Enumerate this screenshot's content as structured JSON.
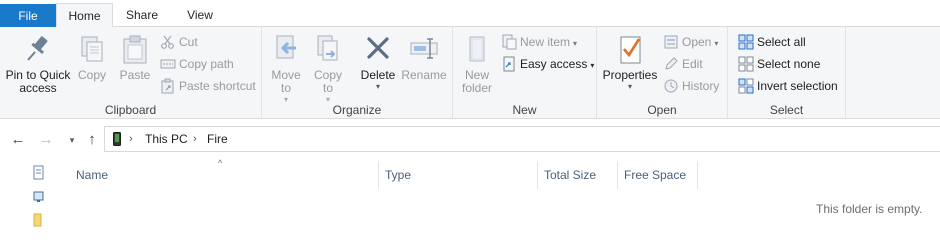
{
  "tabs": {
    "file": "File",
    "home": "Home",
    "share": "Share",
    "view": "View"
  },
  "ribbon": {
    "clipboard": {
      "label": "Clipboard",
      "pin": "Pin to Quick access",
      "copy": "Copy",
      "paste": "Paste",
      "cut": "Cut",
      "copy_path": "Copy path",
      "paste_shortcut": "Paste shortcut"
    },
    "organize": {
      "label": "Organize",
      "move_to": "Move to",
      "copy_to": "Copy to",
      "delete": "Delete",
      "rename": "Rename"
    },
    "new": {
      "label": "New",
      "new_folder": "New folder",
      "new_item": "New item",
      "easy_access": "Easy access"
    },
    "open": {
      "label": "Open",
      "properties": "Properties",
      "open": "Open",
      "edit": "Edit",
      "history": "History"
    },
    "select": {
      "label": "Select",
      "select_all": "Select all",
      "select_none": "Select none",
      "invert_selection": "Invert selection"
    }
  },
  "address": {
    "path": [
      "This PC",
      "Fire"
    ]
  },
  "columns": {
    "name": "Name",
    "type": "Type",
    "total_size": "Total Size",
    "free_space": "Free Space"
  },
  "content": {
    "empty_message": "This folder is empty."
  },
  "colors": {
    "file_tab": "#1979ca",
    "ribbon_bg": "#f5f6f7",
    "column_header_text": "#4c607a",
    "accent_blue": "#2b6fc4"
  }
}
